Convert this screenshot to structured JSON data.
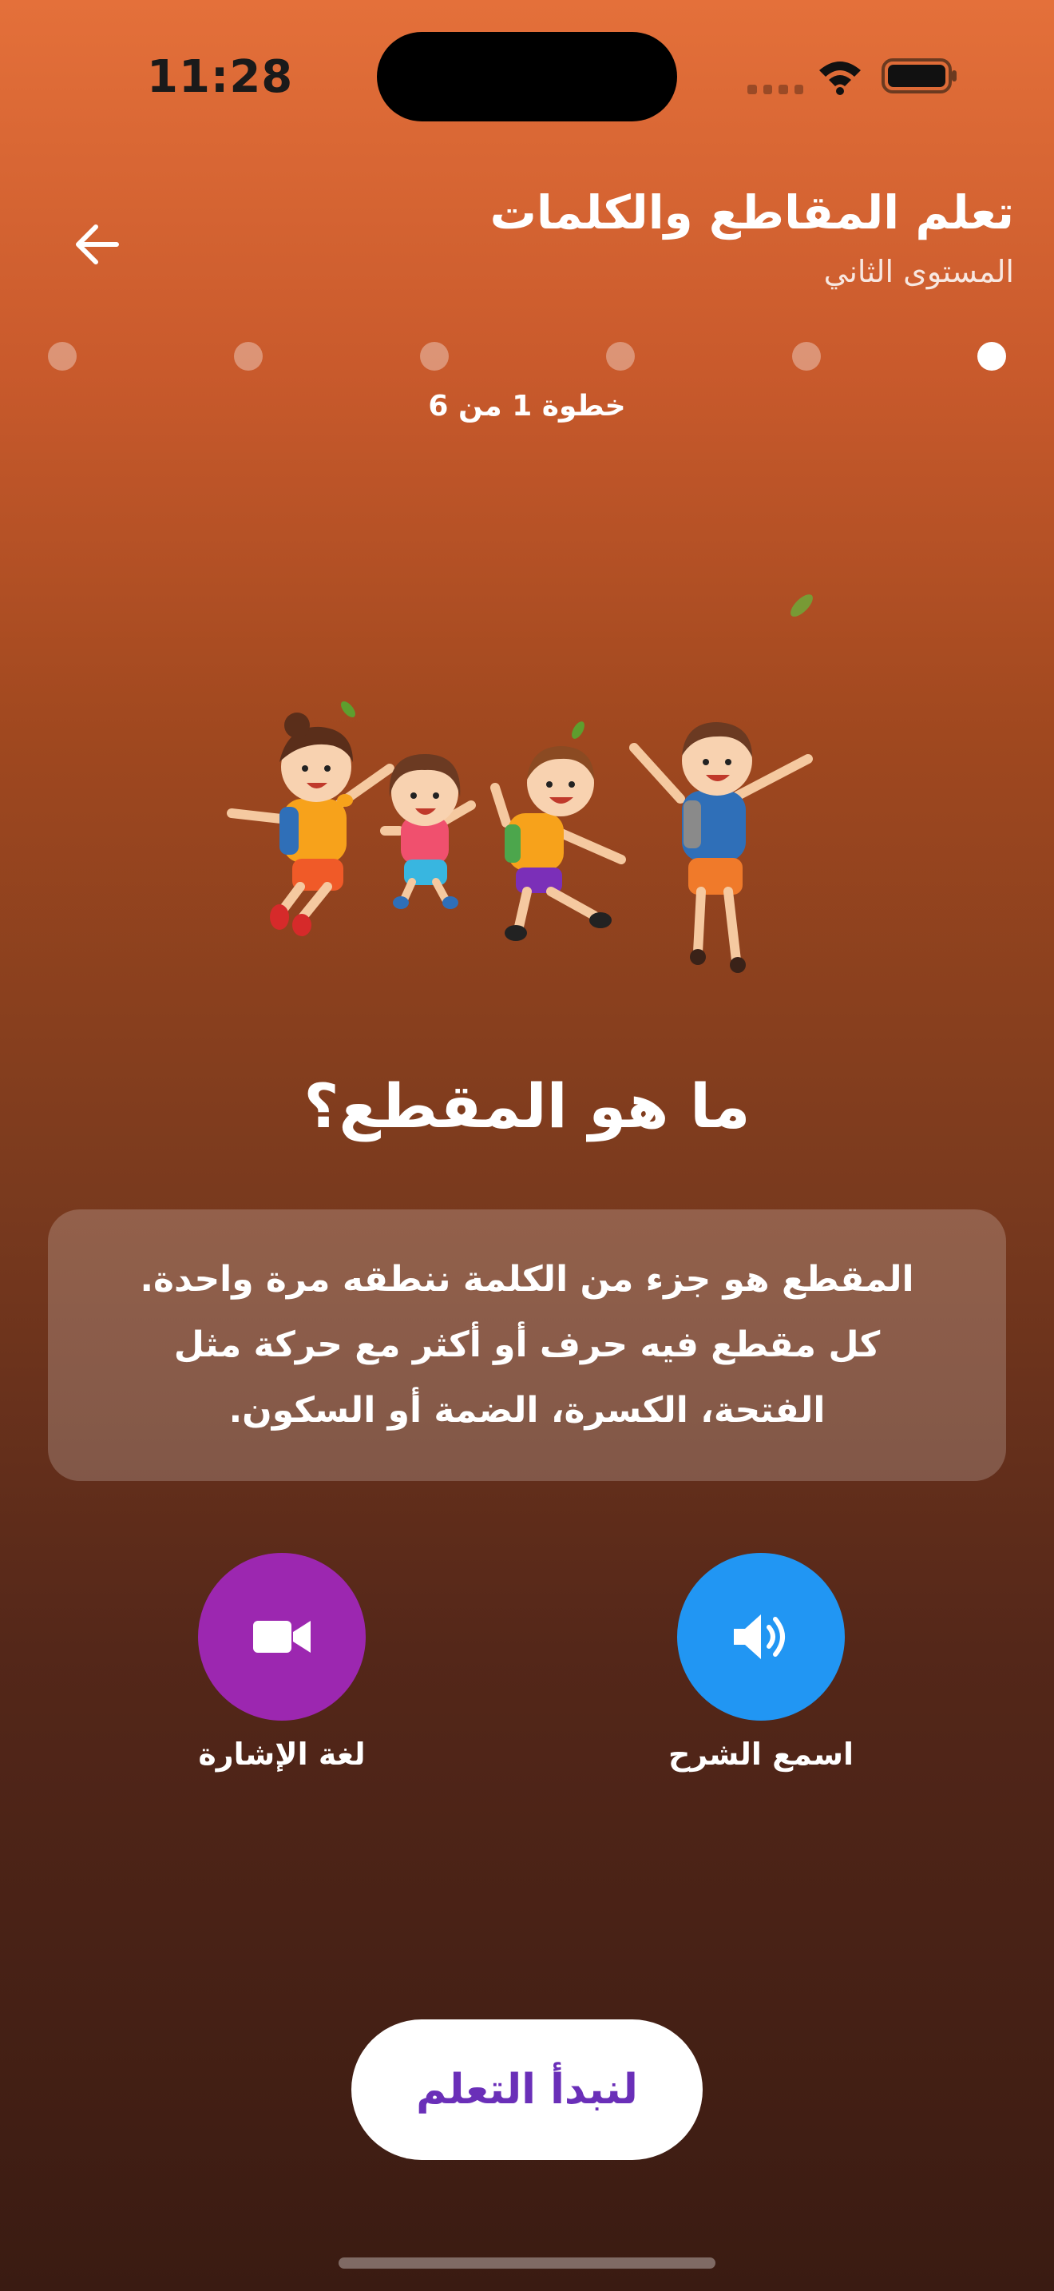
{
  "status_bar": {
    "time": "11:28"
  },
  "header": {
    "title": "تعلم المقاطع والكلمات",
    "subtitle": "المستوى الثاني",
    "back_icon": "arrow-left-icon"
  },
  "progress": {
    "current_step": 1,
    "total_steps": 6,
    "label": "خطوة 1 من 6"
  },
  "lesson": {
    "heading": "ما هو المقطع؟",
    "body_lines": [
      "المقطع هو جزء من الكلمة ننطقه مرة واحدة.",
      "كل مقطع فيه حرف أو أكثر مع حركة مثل",
      "الفتحة، الكسرة، الضمة أو السكون."
    ]
  },
  "actions": {
    "sign_language": {
      "label": "لغة الإشارة",
      "icon": "video-camera-icon",
      "color": "#9C27B0"
    },
    "listen": {
      "label": "اسمع الشرح",
      "icon": "speaker-icon",
      "color": "#2196F3"
    }
  },
  "start_button": {
    "label": "لنبدأ التعلم"
  },
  "colors": {
    "accent_purple": "#6A2FB8",
    "gradient_top": "#E4703A",
    "gradient_bottom": "#3A1B12"
  }
}
